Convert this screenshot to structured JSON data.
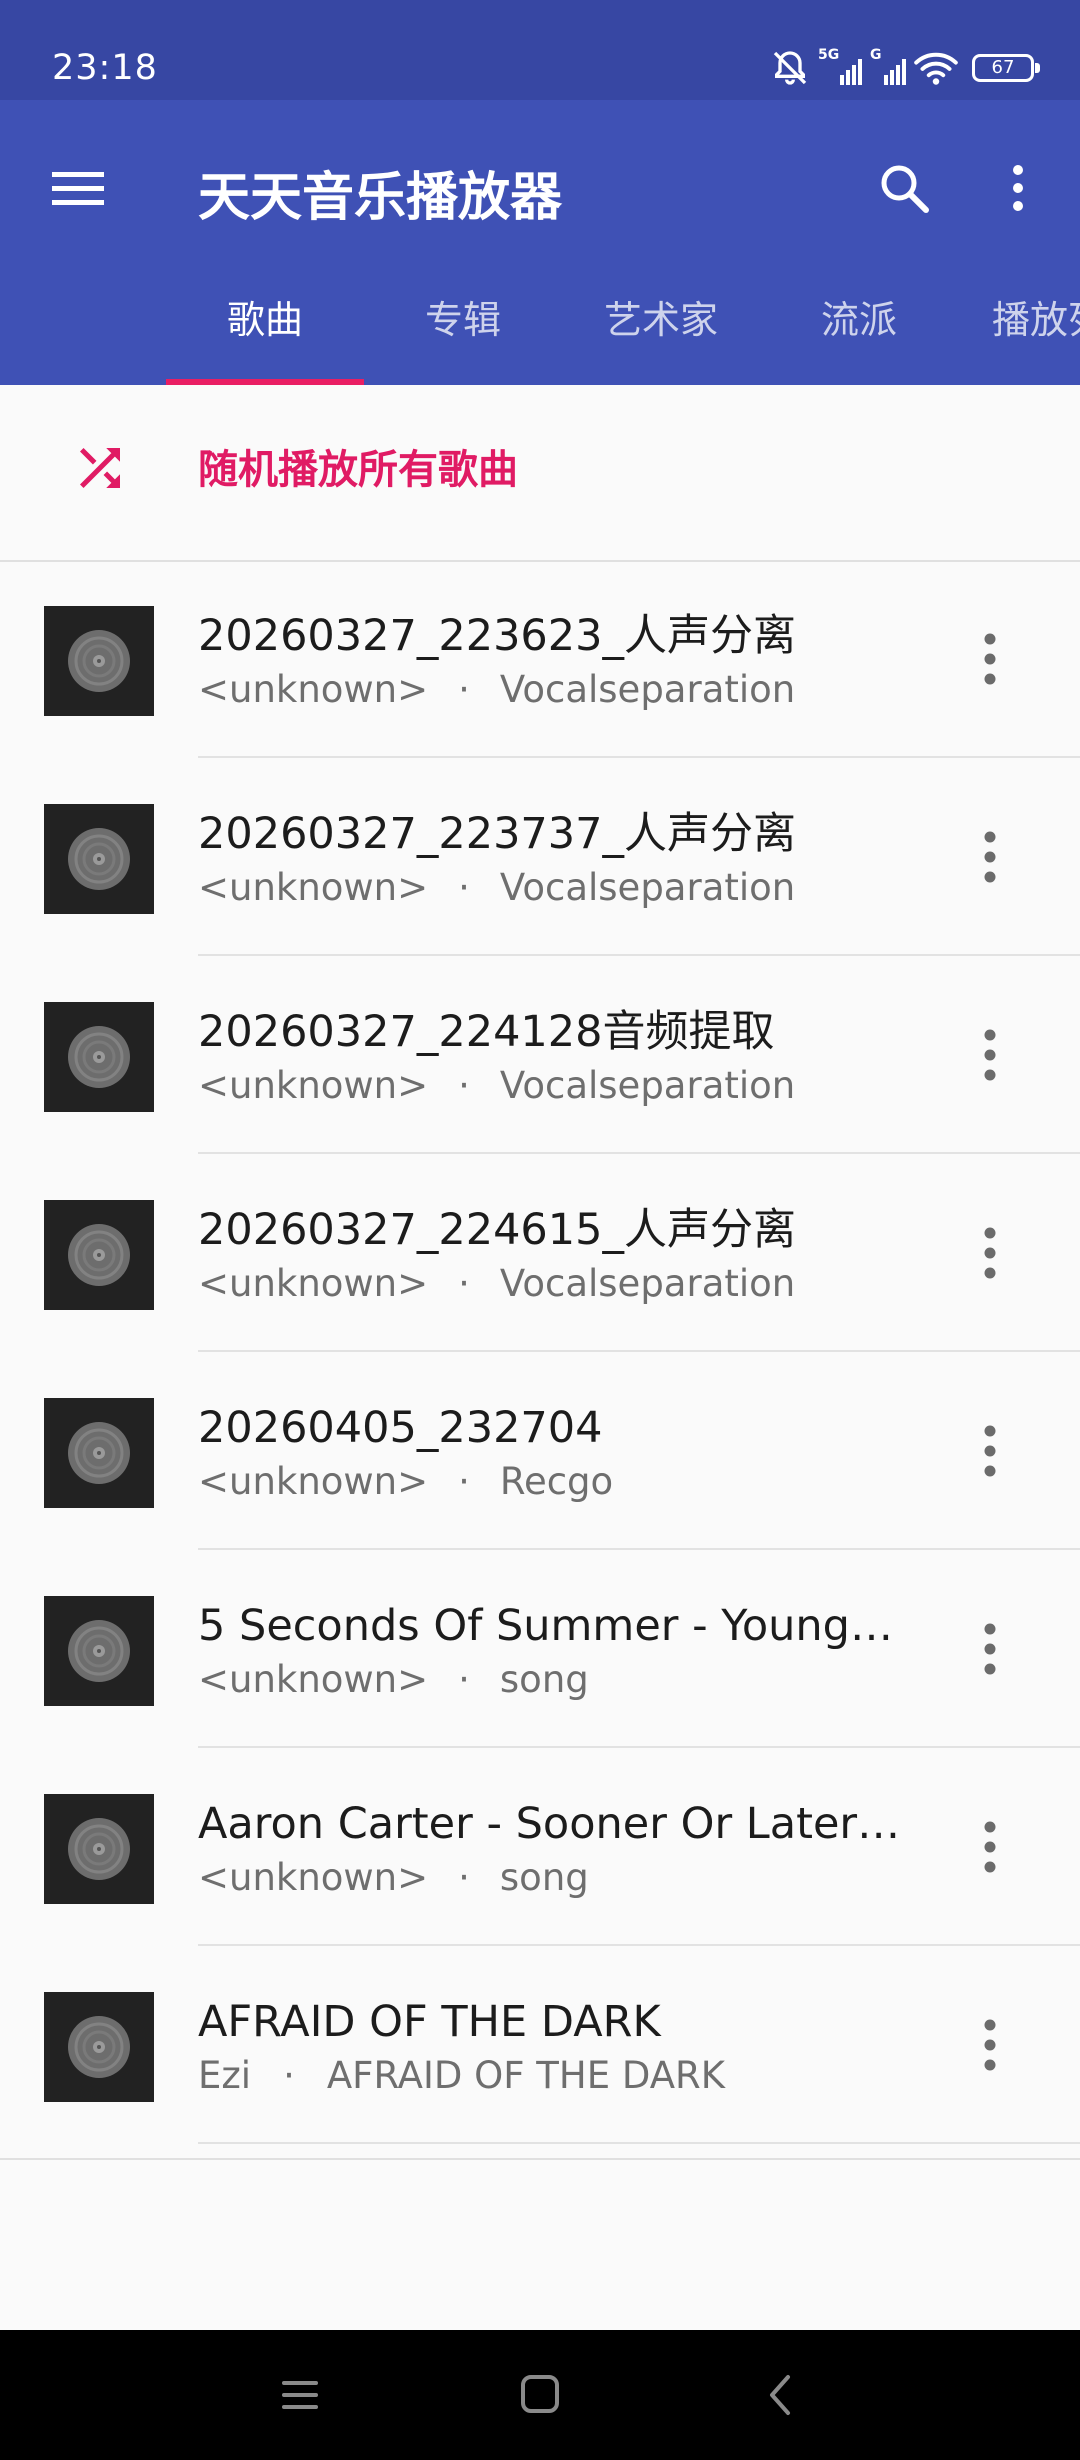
{
  "status_bar": {
    "time": "23:18",
    "network_5g": "5G",
    "network_g": "G",
    "battery": "67",
    "icons": [
      "bell-off-icon",
      "signal-icon",
      "signal-icon",
      "wifi-icon",
      "battery-icon"
    ]
  },
  "app_bar": {
    "title": "天天音乐播放器",
    "menu_icon": "hamburger-menu-icon",
    "search_icon": "search-icon",
    "more_icon": "more-vert-icon",
    "color": "#3f51b5",
    "status_color": "#3747a3"
  },
  "tabs": [
    {
      "label": "歌曲",
      "active": true
    },
    {
      "label": "专辑",
      "active": false
    },
    {
      "label": "艺术家",
      "active": false
    },
    {
      "label": "流派",
      "active": false
    },
    {
      "label": "播放列表",
      "active": false
    }
  ],
  "accent_color": "#e91e63",
  "shuffle": {
    "label": "随机播放所有歌曲",
    "icon": "shuffle-icon"
  },
  "songs": [
    {
      "title": "20260327_223623_人声分离",
      "artist": "<unknown>",
      "separator": "·",
      "album": "Vocalseparation"
    },
    {
      "title": "20260327_223737_人声分离",
      "artist": "<unknown>",
      "separator": "·",
      "album": "Vocalseparation"
    },
    {
      "title": "20260327_224128音频提取",
      "artist": "<unknown>",
      "separator": "·",
      "album": "Vocalseparation"
    },
    {
      "title": "20260327_224615_人声分离",
      "artist": "<unknown>",
      "separator": "·",
      "album": "Vocalseparation"
    },
    {
      "title": "20260405_232704",
      "artist": "<unknown>",
      "separator": "·",
      "album": "Recgo"
    },
    {
      "title": "5 Seconds Of Summer - Young…",
      "artist": "<unknown>",
      "separator": "·",
      "album": "song"
    },
    {
      "title": "Aaron Carter - Sooner Or Later…",
      "artist": "<unknown>",
      "separator": "·",
      "album": "song"
    },
    {
      "title": "AFRAID OF THE DARK",
      "artist": "Ezi",
      "separator": "·",
      "album": "AFRAID OF THE DARK"
    }
  ],
  "nav_bar": {
    "icons": [
      "recent-apps-icon",
      "home-icon",
      "back-icon"
    ]
  }
}
